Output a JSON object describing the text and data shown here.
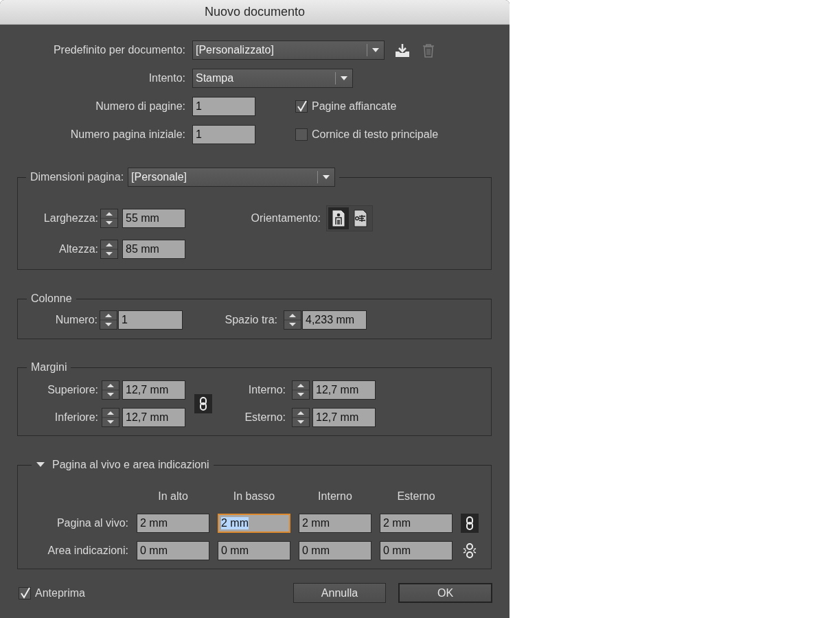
{
  "window": {
    "title": "Nuovo documento"
  },
  "preset": {
    "label": "Predefinito per documento:",
    "value": "[Personalizzato]",
    "delete_disabled": true
  },
  "intent": {
    "label": "Intento:",
    "value": "Stampa"
  },
  "fields": [
    {
      "label": "Numero di pagine:",
      "value": "1"
    },
    {
      "label": "Numero pagina iniziale:",
      "value": "1"
    }
  ],
  "checkboxes": [
    {
      "label": "Pagine affiancate",
      "checked": true
    },
    {
      "label": "Cornice di testo principale",
      "checked": false
    }
  ],
  "page_size": {
    "label": "Dimensioni pagina:",
    "value": "[Personale]",
    "width": {
      "label": "Larghezza:",
      "value": "55 mm"
    },
    "height": {
      "label": "Altezza:",
      "value": "85 mm"
    },
    "orientation": {
      "label": "Orientamento:",
      "options": [
        {
          "kind": "portrait",
          "selected": true
        },
        {
          "kind": "landscape",
          "selected": false
        }
      ]
    }
  },
  "columns": {
    "title": "Colonne",
    "number": {
      "label": "Numero:",
      "value": "1"
    },
    "gutter": {
      "label": "Spazio tra:",
      "value": "4,233 mm"
    }
  },
  "margins": {
    "title": "Margini",
    "linked": true,
    "fields": [
      {
        "label": "Superiore:",
        "value": "12,7 mm"
      },
      {
        "label": "Inferiore:",
        "value": "12,7 mm"
      },
      {
        "label": "Interno:",
        "value": "12,7 mm"
      },
      {
        "label": "Esterno:",
        "value": "12,7 mm"
      }
    ]
  },
  "bleed_slug": {
    "title": "Pagina al vivo e area indicazioni",
    "expanded": true,
    "columns": [
      "In alto",
      "In basso",
      "Interno",
      "Esterno"
    ],
    "rows": [
      {
        "label": "Pagina al vivo:",
        "linked": true,
        "values": [
          {
            "value": "2 mm",
            "focused": false
          },
          {
            "value": "2 mm",
            "focused": true
          },
          {
            "value": "2 mm",
            "focused": false
          },
          {
            "value": "2 mm",
            "focused": false
          }
        ]
      },
      {
        "label": "Area indicazioni:",
        "linked": false,
        "values": [
          {
            "value": "0 mm",
            "focused": false
          },
          {
            "value": "0 mm",
            "focused": false
          },
          {
            "value": "0 mm",
            "focused": false
          },
          {
            "value": "0 mm",
            "focused": false
          }
        ]
      }
    ]
  },
  "preview": {
    "label": "Anteprima",
    "checked": true
  },
  "buttons": [
    {
      "label": "Annulla",
      "default": false
    },
    {
      "label": "OK",
      "default": true
    }
  ]
}
